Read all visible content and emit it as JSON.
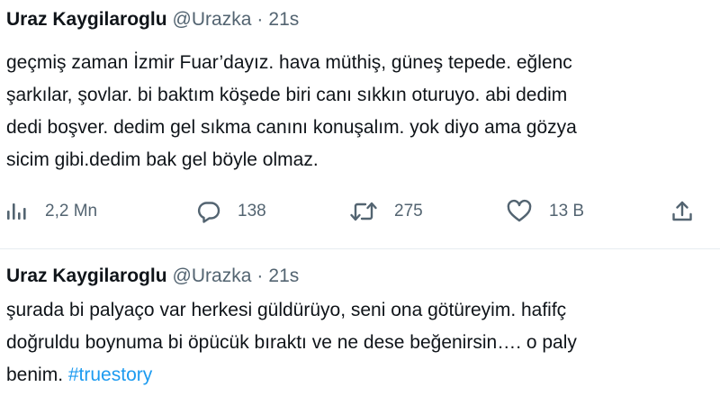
{
  "tweets": [
    {
      "author_name": "Uraz Kaygilaroglu",
      "handle": "@Urazka",
      "separator": "·",
      "time": "21s",
      "lines": [
        "geçmiş zaman İzmir Fuar’dayız. hava müthiş, güneş tepede. eğlenc",
        "şarkılar, şovlar. bi baktım köşede biri canı sıkkın oturuyo. abi dedim",
        "dedi boşver. dedim gel sıkma canını konuşalım. yok diyo ama gözya",
        "sicim gibi.dedim bak gel böyle olmaz."
      ],
      "actions": {
        "views": {
          "icon": "views-chart-icon",
          "count": "2,2 Mn"
        },
        "reply": {
          "icon": "reply-bubble-icon",
          "count": "138"
        },
        "retweet": {
          "icon": "retweet-icon",
          "count": "275"
        },
        "like": {
          "icon": "heart-icon",
          "count": "13 B"
        },
        "share": {
          "icon": "share-icon"
        }
      }
    },
    {
      "author_name": "Uraz Kaygilaroglu",
      "handle": "@Urazka",
      "separator": "·",
      "time": "21s",
      "lines": [
        "şurada bi palyaço var herkesi güldürüyo, seni ona götüreyim. hafifç",
        "doğruldu boynuma bi öpücük bıraktı ve ne dese beğenirsin…. o paly",
        "benim."
      ],
      "hashtag": "#truestory"
    }
  ],
  "colors": {
    "text": "#0f1419",
    "secondary": "#536471",
    "link": "#1d9bf0",
    "divider": "#e6ecf0"
  }
}
